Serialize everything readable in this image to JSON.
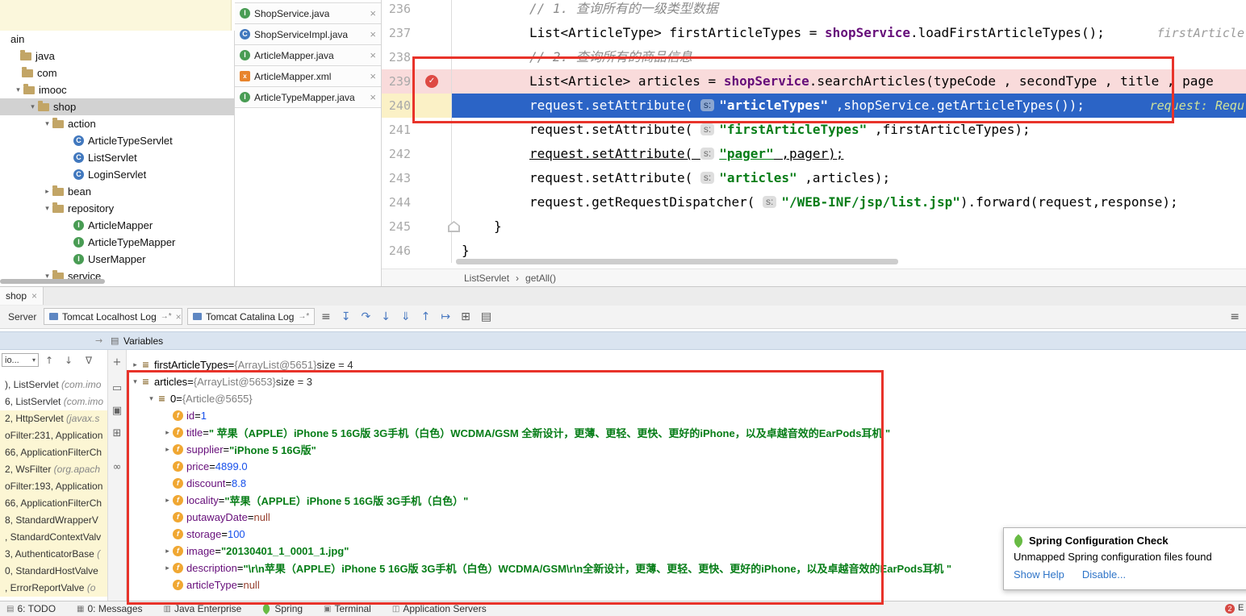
{
  "project_tree": {
    "items": [
      {
        "label": "ain",
        "pad": 0,
        "chevron": "",
        "icon": "",
        "selected": false
      },
      {
        "label": "java",
        "pad": 12,
        "chevron": "",
        "icon": "folder",
        "selected": false
      },
      {
        "label": "com",
        "pad": 14,
        "chevron": "",
        "icon": "folder",
        "selected": false
      },
      {
        "label": "imooc",
        "pad": 16,
        "chevron": "v",
        "icon": "folder",
        "selected": false
      },
      {
        "label": "shop",
        "pad": 34,
        "chevron": "v",
        "icon": "folder",
        "selected": true
      },
      {
        "label": "action",
        "pad": 52,
        "chevron": "v",
        "icon": "folder",
        "selected": false
      },
      {
        "label": "ArticleTypeServlet",
        "pad": 78,
        "chevron": "",
        "icon": "class",
        "selected": false
      },
      {
        "label": "ListServlet",
        "pad": 78,
        "chevron": "",
        "icon": "class",
        "selected": false
      },
      {
        "label": "LoginServlet",
        "pad": 78,
        "chevron": "",
        "icon": "class",
        "selected": false
      },
      {
        "label": "bean",
        "pad": 52,
        "chevron": ">",
        "icon": "folder",
        "selected": false
      },
      {
        "label": "repository",
        "pad": 52,
        "chevron": "v",
        "icon": "folder",
        "selected": false
      },
      {
        "label": "ArticleMapper",
        "pad": 78,
        "chevron": "",
        "icon": "interface",
        "selected": false
      },
      {
        "label": "ArticleTypeMapper",
        "pad": 78,
        "chevron": "",
        "icon": "interface",
        "selected": false
      },
      {
        "label": "UserMapper",
        "pad": 78,
        "chevron": "",
        "icon": "interface",
        "selected": false
      },
      {
        "label": "service",
        "pad": 52,
        "chevron": "v",
        "icon": "folder",
        "selected": false
      }
    ]
  },
  "editor_tabs": [
    {
      "label": "ShopService.java",
      "icon": "interface"
    },
    {
      "label": "ShopServiceImpl.java",
      "icon": "class"
    },
    {
      "label": "ArticleMapper.java",
      "icon": "interface"
    },
    {
      "label": "ArticleMapper.xml",
      "icon": "xml"
    },
    {
      "label": "ArticleTypeMapper.java",
      "icon": "interface"
    }
  ],
  "editor": {
    "lines": [
      {
        "num": "236",
        "indent": 96,
        "bg": "normal",
        "gutter": "",
        "segs": [
          [
            "cmt",
            "// 1. 查询所有的一级类型数据"
          ]
        ]
      },
      {
        "num": "237",
        "indent": 96,
        "bg": "normal",
        "gutter": "",
        "hint": "firstArticle",
        "hintStyle": "gray",
        "segs": [
          [
            "pln",
            "List<ArticleType> firstArticleTypes = "
          ],
          [
            "fld",
            "shopService"
          ],
          [
            "pln",
            ".loadFirstArticleTypes();"
          ]
        ]
      },
      {
        "num": "238",
        "indent": 96,
        "bg": "normal",
        "gutter": "",
        "segs": [
          [
            "cmt",
            "// 2. 查询所有的商品信息"
          ]
        ]
      },
      {
        "num": "239",
        "indent": 96,
        "bg": "break",
        "gutter": "breakpoint",
        "segs": [
          [
            "pln",
            "List<Article> articles = "
          ],
          [
            "fld",
            "shopService"
          ],
          [
            "pln",
            ".searchArticles(typeCode , secondType , title , page"
          ]
        ]
      },
      {
        "num": "240",
        "indent": 96,
        "bg": "exec",
        "gutter": "exec",
        "hint": "request: Requ",
        "hintStyle": "exec",
        "segs": [
          [
            "w",
            "request.setAttribute( "
          ],
          [
            "badge-exec",
            "s:"
          ],
          [
            "wstr",
            "\"articleTypes\""
          ],
          [
            "w",
            " ,shopService.getArticleTypes());"
          ]
        ]
      },
      {
        "num": "241",
        "indent": 96,
        "bg": "normal",
        "gutter": "",
        "segs": [
          [
            "pln",
            "request.setAttribute( "
          ],
          [
            "badge",
            "s:"
          ],
          [
            "str",
            "\"firstArticleTypes\""
          ],
          [
            "pln",
            " ,firstArticleTypes);"
          ]
        ]
      },
      {
        "num": "242",
        "indent": 96,
        "bg": "normal",
        "gutter": "",
        "underline": true,
        "segs": [
          [
            "pln",
            "request.setAttribute( "
          ],
          [
            "badge",
            "s:"
          ],
          [
            "str",
            "\"pager\""
          ],
          [
            "pln",
            " ,pager);"
          ]
        ]
      },
      {
        "num": "243",
        "indent": 96,
        "bg": "normal",
        "gutter": "",
        "segs": [
          [
            "pln",
            "request.setAttribute( "
          ],
          [
            "badge",
            "s:"
          ],
          [
            "str",
            "\"articles\""
          ],
          [
            "pln",
            " ,articles);"
          ]
        ]
      },
      {
        "num": "244",
        "indent": 96,
        "bg": "normal",
        "gutter": "",
        "segs": [
          [
            "pln",
            "request.getRequestDispatcher( "
          ],
          [
            "badge",
            "s:"
          ],
          [
            "str",
            "\"/WEB-INF/jsp/list.jsp\""
          ],
          [
            "pln",
            ").forward(request,response);"
          ]
        ]
      },
      {
        "num": "245",
        "indent": 52,
        "bg": "normal",
        "gutter": "pentagon",
        "segs": [
          [
            "pln",
            "}"
          ]
        ]
      },
      {
        "num": "246",
        "indent": 12,
        "bg": "normal",
        "gutter": "",
        "segs": [
          [
            "pln",
            "}"
          ]
        ]
      }
    ]
  },
  "breadcrumb": {
    "items": [
      "ListServlet",
      "getAll()"
    ],
    "separator": "›"
  },
  "debug": {
    "window_tab": "shop",
    "session_tab": "Server",
    "console_tabs": [
      {
        "label": "Tomcat Localhost Log",
        "suffix": "→*"
      },
      {
        "label": "Tomcat Catalina Log",
        "suffix": "→*"
      }
    ],
    "toolb ar_note": "",
    "toolbar_icons": [
      {
        "name": "view-menu-icon",
        "glyph": "≡",
        "color": "#5a5a5a"
      },
      {
        "name": "show-execution-point-icon",
        "glyph": "↧",
        "color": "#4878c0"
      },
      {
        "name": "step-over-icon",
        "glyph": "↷",
        "color": "#4878c0"
      },
      {
        "name": "step-into-icon",
        "glyph": "↓",
        "color": "#4878c0"
      },
      {
        "name": "force-step-into-icon",
        "glyph": "⇓",
        "color": "#4878c0"
      },
      {
        "name": "step-out-icon",
        "glyph": "↑",
        "color": "#4878c0"
      },
      {
        "name": "run-to-cursor-icon",
        "glyph": "↦",
        "color": "#4878c0"
      },
      {
        "name": "view-breakpoints-icon",
        "glyph": "⊞",
        "color": "#5a5a5a"
      },
      {
        "name": "mute-breakpoints-icon",
        "glyph": "▤",
        "color": "#5a5a5a"
      }
    ],
    "right_icon": "≡",
    "variables_title": "Variables",
    "frames_filter": "io...",
    "frames": [
      {
        "pre": "), ListServlet ",
        "pkg": "(com.imo",
        "lib": false
      },
      {
        "pre": "6, ListServlet ",
        "pkg": "(com.imo",
        "lib": false
      },
      {
        "pre": "2, HttpServlet ",
        "pkg": "(javax.s",
        "lib": true
      },
      {
        "pre": "oFilter:231, Application",
        "pkg": "",
        "lib": true
      },
      {
        "pre": "66, ApplicationFilterCh",
        "pkg": "",
        "lib": true
      },
      {
        "pre": "2, WsFilter ",
        "pkg": "(org.apach",
        "lib": true
      },
      {
        "pre": "oFilter:193, Application",
        "pkg": "",
        "lib": true
      },
      {
        "pre": "66, ApplicationFilterCh",
        "pkg": "",
        "lib": true
      },
      {
        "pre": "8, StandardWrapperV",
        "pkg": "",
        "lib": true
      },
      {
        "pre": ", StandardContextValv",
        "pkg": "",
        "lib": true
      },
      {
        "pre": "3, AuthenticatorBase ",
        "pkg": "(",
        "lib": true
      },
      {
        "pre": "0, StandardHostValve",
        "pkg": "",
        "lib": true
      },
      {
        "pre": ", ErrorReportValve ",
        "pkg": "(o",
        "lib": true
      }
    ],
    "watch_strip_icons": [
      "+",
      "▭",
      "▣",
      "⊞",
      "∞"
    ]
  },
  "variables": {
    "rows": [
      {
        "level": 0,
        "chevron": ">",
        "icon": "list",
        "segs": [
          [
            "name",
            "firstArticleTypes"
          ],
          [
            "eq",
            " = "
          ],
          [
            "ref",
            "{ArrayList@5651} "
          ],
          [
            "meta",
            " size = 4"
          ]
        ]
      },
      {
        "level": 0,
        "chevron": "v",
        "icon": "list",
        "segs": [
          [
            "name",
            "articles"
          ],
          [
            "eq",
            " = "
          ],
          [
            "ref",
            "{ArrayList@5653} "
          ],
          [
            "meta",
            " size = 3"
          ]
        ]
      },
      {
        "level": 1,
        "chevron": "v",
        "icon": "list",
        "segs": [
          [
            "name",
            "0"
          ],
          [
            "eq",
            " = "
          ],
          [
            "ref",
            "{Article@5655}"
          ]
        ]
      },
      {
        "level": 2,
        "chevron": "",
        "icon": "field",
        "segs": [
          [
            "fname",
            "id"
          ],
          [
            "eq",
            " = "
          ],
          [
            "num",
            "1"
          ]
        ]
      },
      {
        "level": 2,
        "chevron": ">",
        "icon": "field",
        "segs": [
          [
            "fname",
            "title"
          ],
          [
            "eq",
            " = "
          ],
          [
            "str",
            "\" 苹果（APPLE）iPhone 5 16G版 3G手机（白色）WCDMA/GSM 全新设计，更薄、更轻、更快、更好的iPhone，以及卓越音效的EarPods耳机 \""
          ]
        ]
      },
      {
        "level": 2,
        "chevron": ">",
        "icon": "field",
        "segs": [
          [
            "fname",
            "supplier"
          ],
          [
            "eq",
            " = "
          ],
          [
            "str",
            "\"iPhone 5 16G版\""
          ]
        ]
      },
      {
        "level": 2,
        "chevron": "",
        "icon": "field",
        "segs": [
          [
            "fname",
            "price"
          ],
          [
            "eq",
            " = "
          ],
          [
            "num",
            "4899.0"
          ]
        ]
      },
      {
        "level": 2,
        "chevron": "",
        "icon": "field",
        "segs": [
          [
            "fname",
            "discount"
          ],
          [
            "eq",
            " = "
          ],
          [
            "num",
            "8.8"
          ]
        ]
      },
      {
        "level": 2,
        "chevron": ">",
        "icon": "field",
        "segs": [
          [
            "fname",
            "locality"
          ],
          [
            "eq",
            " = "
          ],
          [
            "str",
            "\"苹果（APPLE）iPhone 5 16G版 3G手机（白色）\""
          ]
        ]
      },
      {
        "level": 2,
        "chevron": "",
        "icon": "field",
        "segs": [
          [
            "fname",
            "putawayDate"
          ],
          [
            "eq",
            " = "
          ],
          [
            "null",
            "null"
          ]
        ]
      },
      {
        "level": 2,
        "chevron": "",
        "icon": "field",
        "segs": [
          [
            "fname",
            "storage"
          ],
          [
            "eq",
            " = "
          ],
          [
            "num",
            "100"
          ]
        ]
      },
      {
        "level": 2,
        "chevron": ">",
        "icon": "field",
        "segs": [
          [
            "fname",
            "image"
          ],
          [
            "eq",
            " = "
          ],
          [
            "str",
            "\"20130401_1_0001_1.jpg\""
          ]
        ]
      },
      {
        "level": 2,
        "chevron": ">",
        "icon": "field",
        "segs": [
          [
            "fname",
            "description"
          ],
          [
            "eq",
            " = "
          ],
          [
            "str",
            "\"\\r\\n苹果（APPLE）iPhone 5 16G版 3G手机（白色）WCDMA/GSM\\r\\n全新设计，更薄、更轻、更快、更好的iPhone，以及卓越音效的EarPods耳机 \""
          ]
        ]
      },
      {
        "level": 2,
        "chevron": "",
        "icon": "field",
        "segs": [
          [
            "fname",
            "articleType"
          ],
          [
            "eq",
            " = "
          ],
          [
            "null",
            "null"
          ]
        ]
      }
    ]
  },
  "status_bar": {
    "items": [
      {
        "glyph": "▤",
        "label": "6: TODO"
      },
      {
        "glyph": "▦",
        "label": "0: Messages"
      },
      {
        "glyph": "▥",
        "label": "Java Enterprise"
      },
      {
        "glyph": "leaf",
        "label": "Spring"
      },
      {
        "glyph": "▣",
        "label": "Terminal"
      },
      {
        "glyph": "◫",
        "label": "Application Servers"
      }
    ],
    "error_count": "2",
    "error_label": "E"
  },
  "notification": {
    "title": "Spring Configuration Check",
    "body": "Unmapped Spring configuration files found",
    "links": [
      "Show Help",
      "Disable..."
    ]
  }
}
